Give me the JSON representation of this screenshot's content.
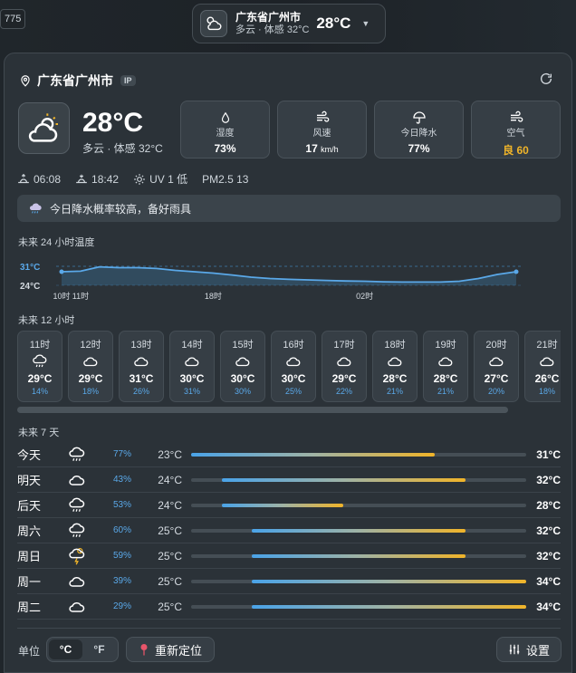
{
  "corner_badge": "775",
  "top_pill": {
    "city": "广东省广州市",
    "sub": "多云 · 体感 32°C",
    "temp": "28°C"
  },
  "panel": {
    "location": "广东省广州市",
    "ip_badge": "IP",
    "current": {
      "temp": "28°C",
      "sub": "多云 · 体感 32°C",
      "icon": "partly-cloudy-icon"
    },
    "metrics": [
      {
        "label": "湿度",
        "value": "73%",
        "unit": "",
        "icon": "droplet-icon"
      },
      {
        "label": "风速",
        "value": "17",
        "unit": "km/h",
        "icon": "wind-icon"
      },
      {
        "label": "今日降水",
        "value": "77%",
        "unit": "",
        "icon": "umbrella-icon"
      },
      {
        "label": "空气",
        "value": "良 60",
        "unit": "",
        "icon": "wind-icon"
      }
    ],
    "sun": {
      "sunrise": "06:08",
      "sunset": "18:42",
      "uv": "UV 1 低",
      "pm": "PM2.5 13"
    },
    "alert": "今日降水概率较高，备好雨具",
    "chart24_title": "未来 24 小时温度",
    "hourly_title": "未来 12 小时",
    "daily_title": "未来 7 天",
    "unit_label": "单位",
    "unit_c": "°C",
    "unit_f": "°F",
    "relocate": "重新定位",
    "settings": "设置"
  },
  "chart_data": {
    "type": "area",
    "title": "未来 24 小时温度",
    "x": [
      "10时",
      "11时",
      "12时",
      "13时",
      "14时",
      "15时",
      "16时",
      "17时",
      "18时",
      "19时",
      "20时",
      "21时",
      "22时",
      "23时",
      "00时",
      "01时",
      "02时",
      "03时",
      "04时",
      "05时",
      "06时",
      "07时",
      "08时",
      "09时",
      "10时"
    ],
    "y": [
      29,
      29.2,
      30.8,
      30.5,
      30.5,
      30.2,
      29.5,
      29,
      28.5,
      27.8,
      27,
      26.5,
      26.2,
      26,
      25.8,
      25.6,
      25.5,
      25.3,
      25.2,
      25.2,
      25.2,
      25.5,
      26.5,
      28,
      29
    ],
    "tick_labels": [
      "11时",
      "18时",
      "02时",
      "10时"
    ],
    "ylabels": [
      "31°C",
      "24°C"
    ],
    "ylim": [
      24,
      31
    ]
  },
  "hourly": [
    {
      "hour": "11时",
      "temp": "29°C",
      "pop": "14%",
      "icon": "rain-cloud-icon"
    },
    {
      "hour": "12时",
      "temp": "29°C",
      "pop": "18%",
      "icon": "cloud-icon"
    },
    {
      "hour": "13时",
      "temp": "31°C",
      "pop": "26%",
      "icon": "cloud-icon"
    },
    {
      "hour": "14时",
      "temp": "30°C",
      "pop": "31%",
      "icon": "cloud-icon"
    },
    {
      "hour": "15时",
      "temp": "30°C",
      "pop": "30%",
      "icon": "cloud-icon"
    },
    {
      "hour": "16时",
      "temp": "30°C",
      "pop": "25%",
      "icon": "cloud-icon"
    },
    {
      "hour": "17时",
      "temp": "29°C",
      "pop": "22%",
      "icon": "cloud-icon"
    },
    {
      "hour": "18时",
      "temp": "28°C",
      "pop": "21%",
      "icon": "cloud-icon"
    },
    {
      "hour": "19时",
      "temp": "28°C",
      "pop": "21%",
      "icon": "cloud-icon"
    },
    {
      "hour": "20时",
      "temp": "27°C",
      "pop": "20%",
      "icon": "cloud-icon"
    },
    {
      "hour": "21时",
      "temp": "26°C",
      "pop": "18%",
      "icon": "cloud-icon"
    }
  ],
  "daily": [
    {
      "name": "今天",
      "pop": "77%",
      "lo": "23°C",
      "hi": "31°C",
      "lo_v": 23,
      "hi_v": 31,
      "icon": "rain-cloud-icon"
    },
    {
      "name": "明天",
      "pop": "43%",
      "lo": "24°C",
      "hi": "32°C",
      "lo_v": 24,
      "hi_v": 32,
      "icon": "cloud-icon"
    },
    {
      "name": "后天",
      "pop": "53%",
      "lo": "24°C",
      "hi": "28°C",
      "lo_v": 24,
      "hi_v": 28,
      "icon": "rain-cloud-icon"
    },
    {
      "name": "周六",
      "pop": "60%",
      "lo": "25°C",
      "hi": "32°C",
      "lo_v": 25,
      "hi_v": 32,
      "icon": "rain-cloud-icon"
    },
    {
      "name": "周日",
      "pop": "59%",
      "lo": "25°C",
      "hi": "32°C",
      "lo_v": 25,
      "hi_v": 32,
      "icon": "thunder-cloud-icon"
    },
    {
      "name": "周一",
      "pop": "39%",
      "lo": "25°C",
      "hi": "34°C",
      "lo_v": 25,
      "hi_v": 34,
      "icon": "cloud-icon"
    },
    {
      "name": "周二",
      "pop": "29%",
      "lo": "25°C",
      "hi": "34°C",
      "lo_v": 25,
      "hi_v": 34,
      "icon": "cloud-icon"
    }
  ],
  "colors": {
    "accent_blue": "#4aa3e8",
    "accent_yellow": "#f0b429",
    "pop_blue": "#5aa8e8"
  }
}
